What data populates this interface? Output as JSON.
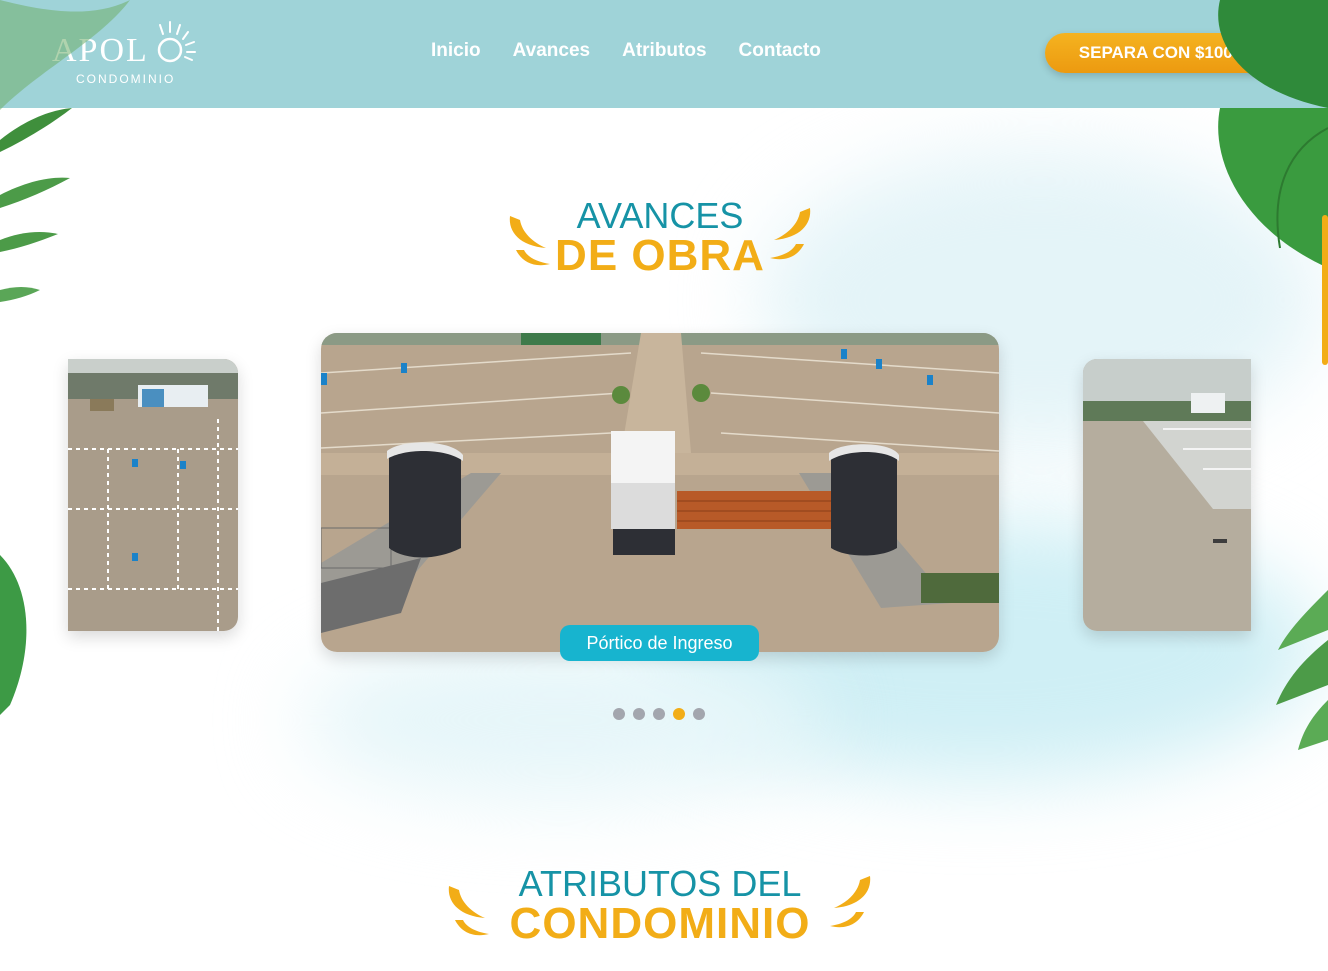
{
  "header": {
    "logo_word": "APOL",
    "logo_sub": "CONDOMINIO",
    "nav": [
      {
        "label": "Inicio"
      },
      {
        "label": "Avances"
      },
      {
        "label": "Atributos"
      },
      {
        "label": "Contacto"
      }
    ],
    "cta_label": "SEPARA CON $1000"
  },
  "avances": {
    "title_top": "AVANCES",
    "title_bottom": "DE OBRA"
  },
  "carousel": {
    "caption": "Pórtico de Ingreso",
    "slide_count": 5,
    "active_index": 3
  },
  "atributos": {
    "title_top": "ATRIBUTOS DEL",
    "title_bottom": "CONDOMINIO"
  },
  "colors": {
    "header_bg": "#9fd3d8",
    "accent_orange": "#f2ad17",
    "accent_teal": "#1693a6",
    "caption_bg": "#17b4cf"
  }
}
